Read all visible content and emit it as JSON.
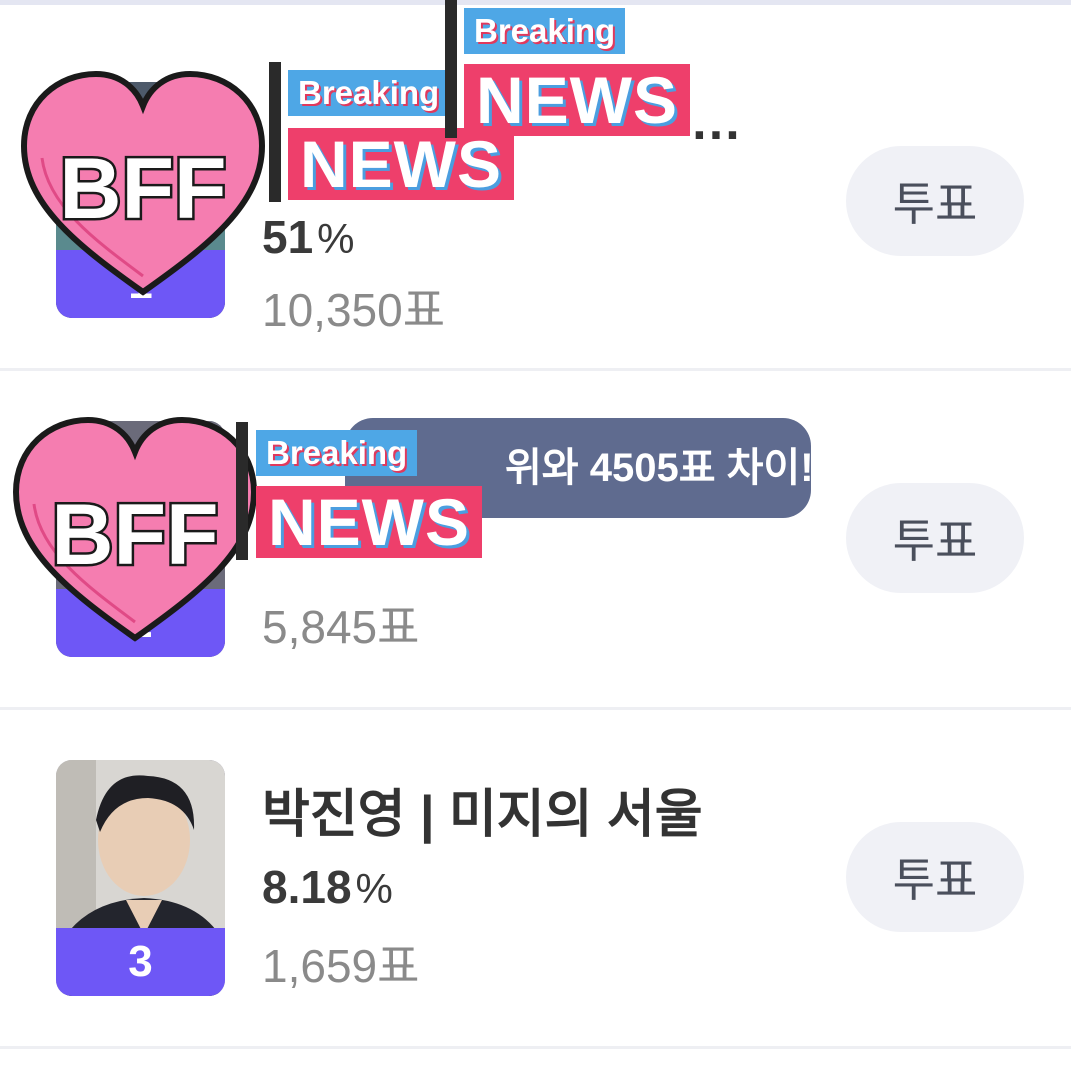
{
  "candidates": [
    {
      "rank": "1",
      "name": "…",
      "percent": "51",
      "percent_unit": "%",
      "votes": "10,350표",
      "vote_label": "투표"
    },
    {
      "rank": "2",
      "name": "",
      "percent": "",
      "percent_unit": "",
      "votes": "5,845표",
      "vote_label": "투표",
      "gap_message": "위와 4505표 차이!"
    },
    {
      "rank": "3",
      "name": "박진영 | 미지의 서울",
      "percent": "8.18",
      "percent_unit": "%",
      "votes": "1,659표",
      "vote_label": "투표"
    }
  ],
  "stickers": {
    "heart_text": "BFF",
    "breaking_text": "Breaking",
    "news_text": "NEWS"
  },
  "colors": {
    "rank_bar": "#6e57f6",
    "vote_button_bg": "#f0f1f6",
    "gap_bubble_bg": "#5f6b8f",
    "heart_fill": "#f57db0",
    "news_bg": "#ee3f6b",
    "breaking_bg": "#4ea7e6"
  }
}
